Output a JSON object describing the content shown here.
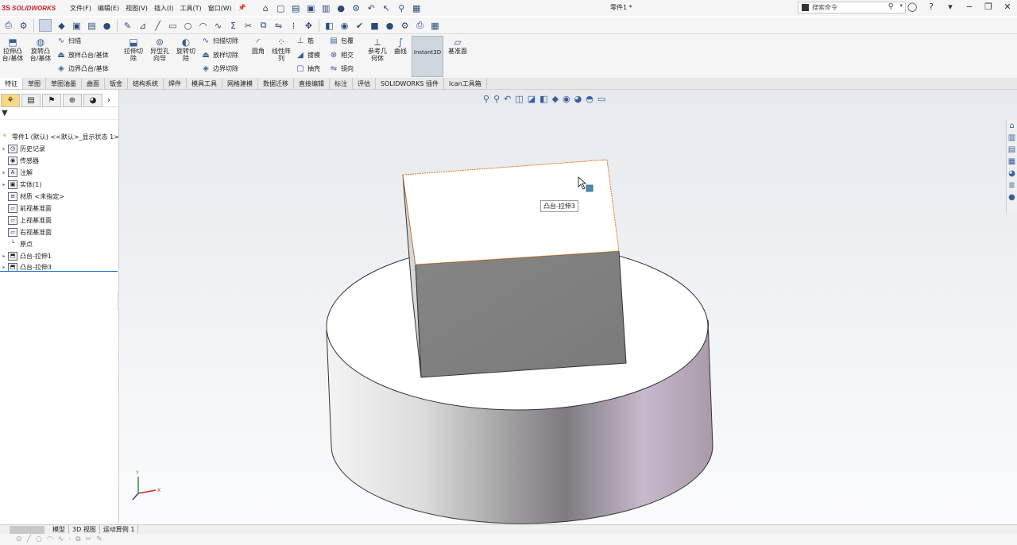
{
  "app": {
    "logo_ds": "3S",
    "logo_text": "SOLIDWORKS",
    "doc_title": "零件1 *"
  },
  "menu": [
    "文件(F)",
    "编辑(E)",
    "视图(V)",
    "插入(I)",
    "工具(T)",
    "窗口(W)"
  ],
  "search": {
    "placeholder": "搜索命令"
  },
  "ribbon": {
    "extrude_boss": "拉伸凸\n台/基体",
    "revolve_boss": "旋转凸\n台/基体",
    "sweep": "扫描",
    "loft": "放样凸台/基体",
    "boundary": "边界凸台/基体",
    "extrude_cut": "拉伸切\n除",
    "hole_wizard": "异型孔\n向导",
    "revolve_cut": "旋转切\n除",
    "sweep_cut": "扫描切除",
    "loft_cut": "放样切除",
    "boundary_cut": "边界切除",
    "fillet": "圆角",
    "linear_pattern": "线性阵\n列",
    "rib": "筋",
    "draft": "拔模",
    "shell": "抽壳",
    "wrap": "包覆",
    "intersect": "相交",
    "mirror": "镜向",
    "ref_geometry": "参考几\n何体",
    "curves": "曲线",
    "instant3d": "Instant3D",
    "datum_plane": "基准面"
  },
  "tabs": [
    "特征",
    "草图",
    "草图油墨",
    "曲面",
    "钣金",
    "结构系统",
    "焊件",
    "模具工具",
    "网格建模",
    "数据迁移",
    "直接编辑",
    "标注",
    "评估",
    "SOLIDWORKS 插件",
    "Ican工具箱"
  ],
  "tree": {
    "root": "零件1 (默认) <<默认>_显示状态 1>",
    "items": [
      "历史记录",
      "传感器",
      "注解",
      "实体(1)",
      "材质 <未指定>",
      "前视基准面",
      "上视基准面",
      "右视基准面",
      "原点",
      "凸台-拉伸1",
      "凸台-拉伸3"
    ]
  },
  "viewport": {
    "tooltip": "凸台-拉伸3"
  },
  "bottom_tabs": [
    "模型",
    "3D 视图",
    "运动算例 1"
  ]
}
